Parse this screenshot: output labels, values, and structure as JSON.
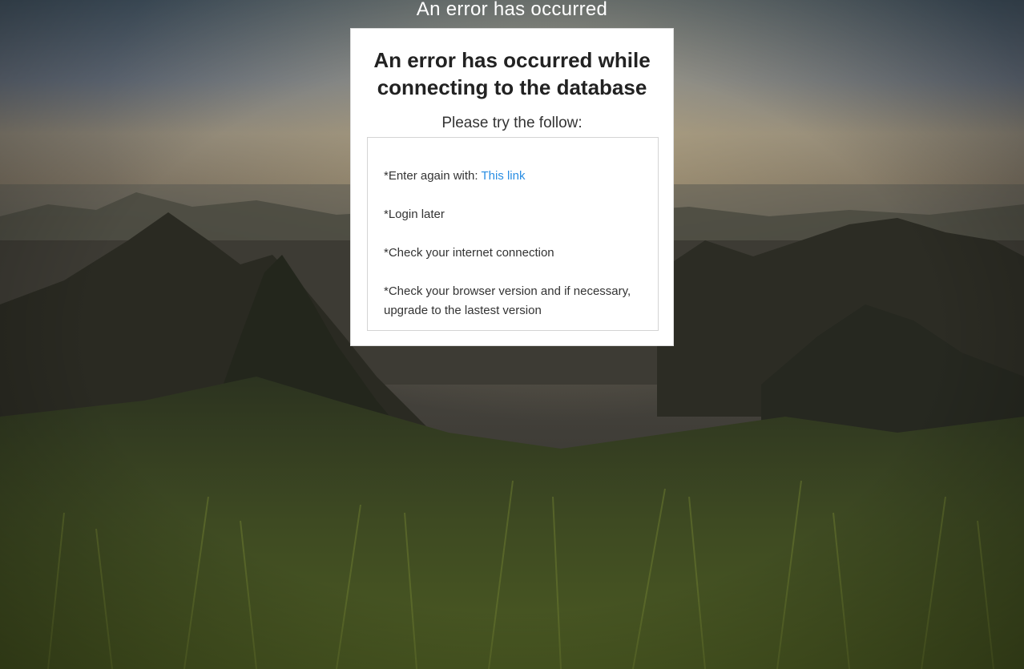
{
  "page": {
    "title": "An error has occurred"
  },
  "card": {
    "heading": "An error has occurred while connecting to the database",
    "subtitle": "Please try the follow:",
    "tips": [
      {
        "prefix": "*Enter again with: ",
        "link": "This link"
      },
      {
        "text": "*Login later"
      },
      {
        "text": "*Check your internet connection"
      },
      {
        "text": "*Check your browser version and if necessary, upgrade to the lastest version"
      }
    ]
  },
  "colors": {
    "link": "#2a8ee3",
    "card_background": "#ffffff",
    "title_text": "#ffffff"
  },
  "background": {
    "description_icon": "landscape-photo"
  }
}
